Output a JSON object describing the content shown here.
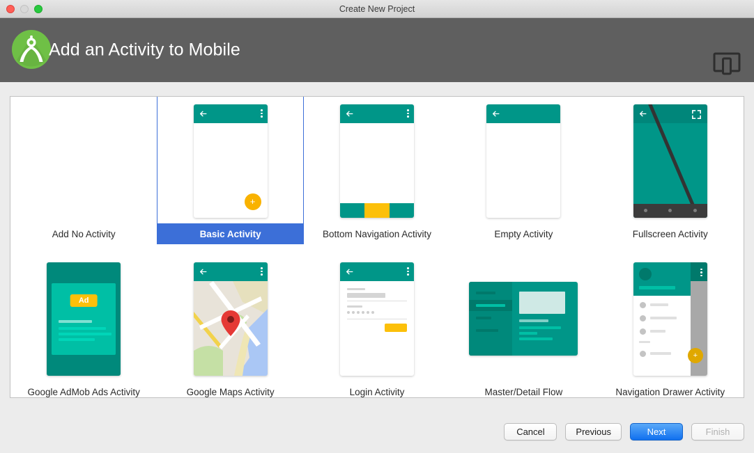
{
  "window": {
    "title": "Create New Project",
    "traffic_lights": [
      "close-button",
      "minimize-button",
      "zoom-button"
    ]
  },
  "header": {
    "title": "Add an Activity to Mobile",
    "logo_icon": "android-studio-logo",
    "form_factor_icon": "tablet-and-phone-icon",
    "accent_color": "#5f5f5f"
  },
  "templates": [
    {
      "id": "add-no-activity",
      "label": "Add No Activity",
      "thumbnail": "none",
      "selected": false
    },
    {
      "id": "basic-activity",
      "label": "Basic Activity",
      "thumbnail": "phone-appbar-fab",
      "selected": true
    },
    {
      "id": "bottom-navigation-activity",
      "label": "Bottom Navigation Activity",
      "thumbnail": "phone-appbar-bottomnav",
      "selected": false
    },
    {
      "id": "empty-activity",
      "label": "Empty Activity",
      "thumbnail": "phone-appbar-blank",
      "selected": false
    },
    {
      "id": "fullscreen-activity",
      "label": "Fullscreen Activity",
      "thumbnail": "phone-fullscreen-diagonal",
      "selected": false
    },
    {
      "id": "google-admob-ads-activity",
      "label": "Google AdMob Ads Activity",
      "thumbnail": "phone-admob-card",
      "selected": false
    },
    {
      "id": "google-maps-activity",
      "label": "Google Maps Activity",
      "thumbnail": "phone-map-pin",
      "selected": false
    },
    {
      "id": "login-activity",
      "label": "Login Activity",
      "thumbnail": "phone-login-form",
      "selected": false
    },
    {
      "id": "master-detail-flow",
      "label": "Master/Detail Flow",
      "thumbnail": "tablet-master-detail",
      "selected": false
    },
    {
      "id": "navigation-drawer-activity",
      "label": "Navigation Drawer Activity",
      "thumbnail": "phone-nav-drawer",
      "selected": false
    }
  ],
  "admob_badge": "Ad",
  "fab_glyph": "+",
  "footer": {
    "cancel": "Cancel",
    "previous": "Previous",
    "next": "Next",
    "finish": "Finish",
    "next_is_default": true,
    "finish_disabled": true
  },
  "colors": {
    "teal": "#009688",
    "teal_dark": "#00897b",
    "teal_light": "#00bfa5",
    "amber": "#fcc00a",
    "selection_blue": "#3c6fd8",
    "header_gray": "#5f5f5f"
  }
}
